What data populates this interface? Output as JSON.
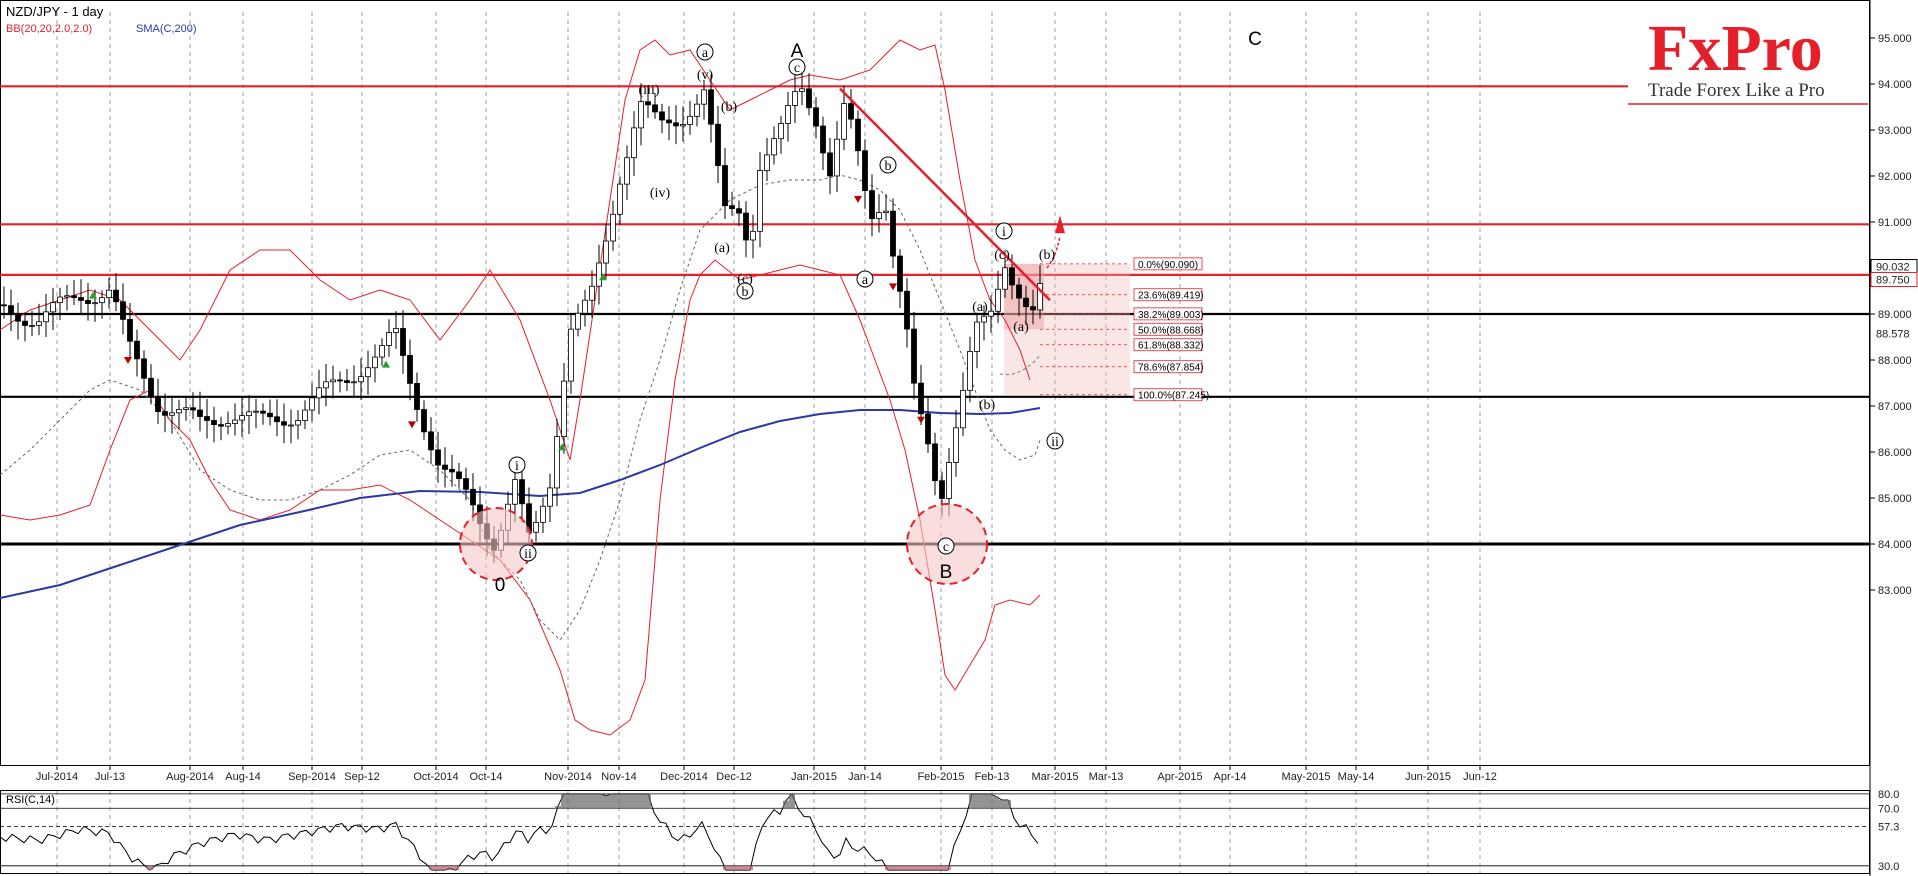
{
  "chart_data": {
    "type": "candlestick",
    "title": "NZD/JPY - 1 day",
    "indicators_label": {
      "bb": "BB(20,20,2.0,2.0)",
      "sma": "SMA(C,200)"
    },
    "y_ticks": [
      "83.000",
      "84.000",
      "85.000",
      "86.000",
      "87.000",
      "88.000",
      "89.000",
      "90.000",
      "91.000",
      "92.000",
      "93.000",
      "94.000",
      "95.000"
    ],
    "y_range": [
      82.4,
      95.9
    ],
    "x_ticks": [
      "Jul-2014",
      "Jul-13",
      "Aug-2014",
      "Aug-14",
      "Sep-2014",
      "Sep-12",
      "Oct-2014",
      "Oct-14",
      "Nov-2014",
      "Nov-14",
      "Dec-2014",
      "Dec-12",
      "Jan-2015",
      "Jan-14",
      "Feb-2015",
      "Feb-13",
      "Mar-2015",
      "Mar-13",
      "Apr-2015",
      "Apr-14",
      "May-2015",
      "May-14",
      "Jun-2015",
      "Jun-12"
    ],
    "price_labels": [
      {
        "text": "90.032",
        "value": 90.032,
        "style": "outline"
      },
      {
        "text": "89.750",
        "value": 89.75,
        "style": "red"
      },
      {
        "text": "88.578",
        "value": 88.578,
        "style": "plain"
      }
    ],
    "horizontal_levels": [
      {
        "value": 93.95,
        "color": "#e4202b"
      },
      {
        "value": 90.95,
        "color": "#e4202b"
      },
      {
        "value": 89.85,
        "color": "#e4202b"
      },
      {
        "value": 89.0,
        "color": "#000000"
      },
      {
        "value": 87.2,
        "color": "#000000"
      },
      {
        "value": 84.0,
        "color": "#000000"
      }
    ],
    "fib_levels": [
      {
        "label": "0.0%(90.090)",
        "value": 90.09
      },
      {
        "label": "23.6%(89.419)",
        "value": 89.419
      },
      {
        "label": "38.2%(89.003)",
        "value": 89.003
      },
      {
        "label": "50.0%(88.668)",
        "value": 88.668
      },
      {
        "label": "61.8%(88.332)",
        "value": 88.332
      },
      {
        "label": "78.6%(87.854)",
        "value": 87.854
      },
      {
        "label": "100.0%(87.245)",
        "value": 87.245
      }
    ],
    "wave_labels": [
      {
        "text": "A",
        "x": 797,
        "y": 51,
        "big": true
      },
      {
        "text": "B",
        "x": 946,
        "y": 572,
        "big": true
      },
      {
        "text": "C",
        "x": 1255,
        "y": 39,
        "big": true
      },
      {
        "text": "0",
        "x": 500,
        "y": 585,
        "big": true
      },
      {
        "text": "a",
        "x": 705,
        "y": 57,
        "circle": true
      },
      {
        "text": "(v)",
        "x": 705,
        "y": 75
      },
      {
        "text": "c",
        "x": 797,
        "y": 72,
        "circle": true
      },
      {
        "text": "(iii)",
        "x": 649,
        "y": 90
      },
      {
        "text": "(b)",
        "x": 729,
        "y": 107
      },
      {
        "text": "(iv)",
        "x": 660,
        "y": 193
      },
      {
        "text": "(a)",
        "x": 722,
        "y": 248
      },
      {
        "text": "(c)",
        "x": 745,
        "y": 279
      },
      {
        "text": "b",
        "x": 745,
        "y": 296,
        "circle": true
      },
      {
        "text": "b",
        "x": 888,
        "y": 170,
        "circle": true
      },
      {
        "text": "a",
        "x": 865,
        "y": 284,
        "circle": true
      },
      {
        "text": "(a)",
        "x": 980,
        "y": 307
      },
      {
        "text": "(b)",
        "x": 987,
        "y": 405
      },
      {
        "text": "c",
        "x": 946,
        "y": 551,
        "circle": true
      },
      {
        "text": "i",
        "x": 1004,
        "y": 236,
        "circle": true
      },
      {
        "text": "(c)",
        "x": 1002,
        "y": 255
      },
      {
        "text": "(a)",
        "x": 1021,
        "y": 327
      },
      {
        "text": "(b)",
        "x": 1047,
        "y": 255
      },
      {
        "text": "ii",
        "x": 1055,
        "y": 446,
        "circle": true
      },
      {
        "text": "i",
        "x": 517,
        "y": 470,
        "circle": true
      },
      {
        "text": "ii",
        "x": 528,
        "y": 558,
        "circle": true
      }
    ],
    "rsi": {
      "label": "RSI(C,14)",
      "ticks": [
        "80.0",
        "70.0",
        "57.3",
        "30.0"
      ],
      "range": [
        25,
        82
      ]
    },
    "legend": "top-left"
  },
  "logo": {
    "brand": "FxPro",
    "tagline": "Trade Forex Like a Pro"
  },
  "colors": {
    "red": "#e4202b",
    "blue": "#2b3aa0",
    "gray": "#777777"
  }
}
